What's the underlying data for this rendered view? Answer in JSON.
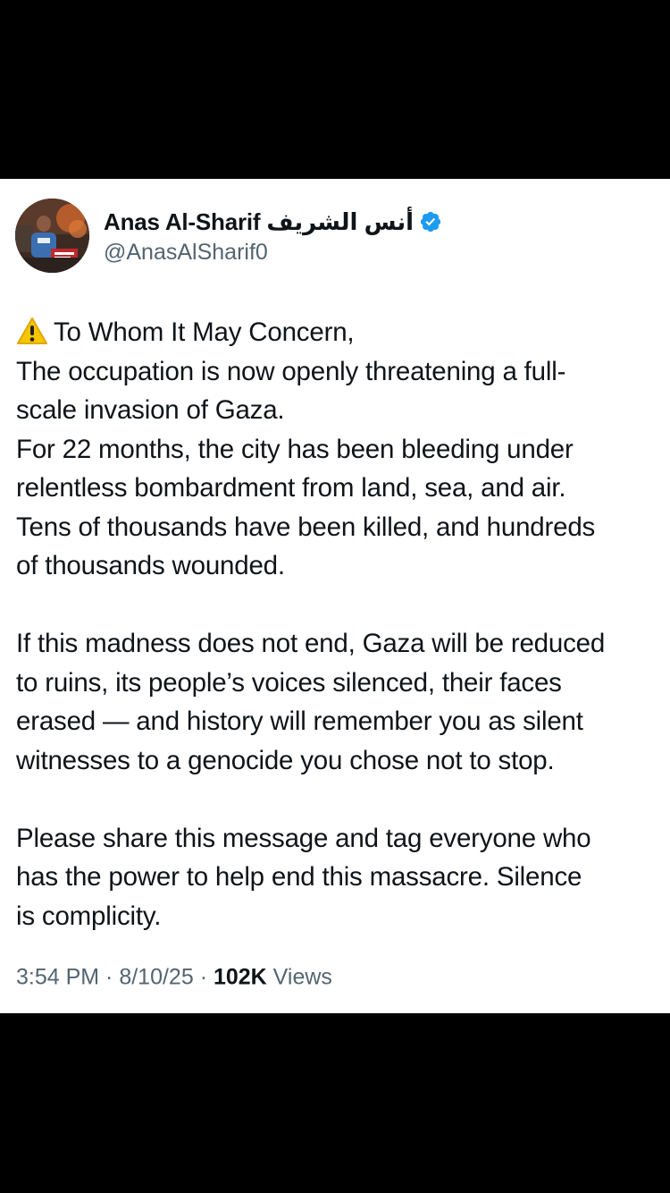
{
  "author": {
    "display_name": "Anas Al-Sharif أنس الشريف",
    "handle": "@AnasAlSharif0",
    "verified_icon": "verified-badge-icon",
    "avatar": "profile-photo"
  },
  "tweet": {
    "lead_icon": "warning-icon",
    "lines": [
      "To Whom It May Concern,",
      "The occupation is now openly threatening a full-",
      "scale invasion of Gaza.",
      "For 22 months, the city has been bleeding under",
      "relentless bombardment from land, sea, and air.",
      "Tens of thousands have been killed, and hundreds",
      "of thousands wounded.",
      "",
      "If this madness does not end, Gaza will be reduced",
      "to ruins, its people’s voices silenced, their faces",
      "erased — and history will remember you as silent",
      "witnesses to a genocide you chose not to stop.",
      "",
      "Please share this message and tag everyone who",
      "has the power to help end this massacre. Silence",
      "is complicity."
    ]
  },
  "meta": {
    "time": "3:54 PM",
    "separator": " · ",
    "date": "8/10/25",
    "views_count": "102K",
    "views_label": " Views"
  },
  "colors": {
    "text_primary": "#0f1419",
    "text_secondary": "#536471",
    "verified_blue": "#1d9bf0",
    "warning_yellow": "#f7c600",
    "background": "#ffffff",
    "letterbox": "#000000"
  }
}
